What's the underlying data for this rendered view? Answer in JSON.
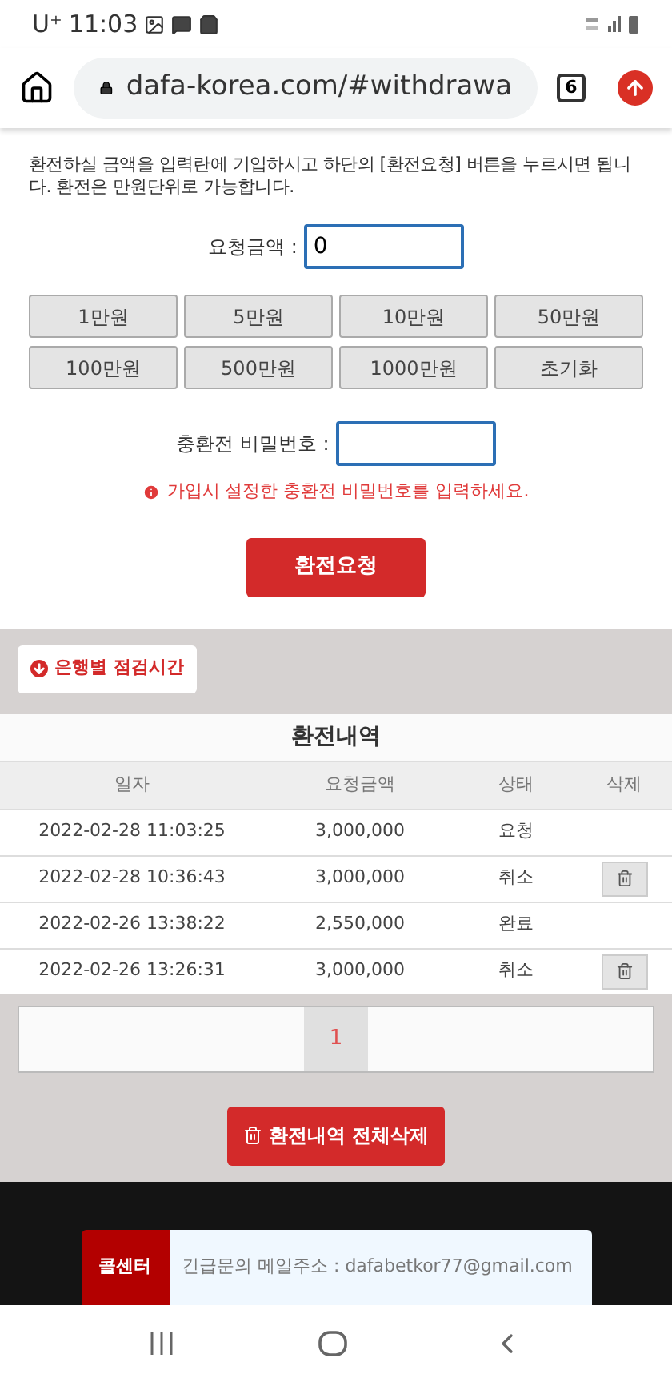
{
  "status_bar": {
    "carrier": "U⁺",
    "time": "11:03"
  },
  "browser": {
    "url": "dafa-korea.com/#withdrawa",
    "tab_count": "6"
  },
  "intro": "환전하실 금액을 입력란에 기입하시고 하단의 [환전요청] 버튼을 누르시면 됩니다. 환전은 만원단위로 가능합니다.",
  "amount": {
    "label": "요청금액 :",
    "value": "0"
  },
  "quick_buttons": [
    "1만원",
    "5만원",
    "10만원",
    "50만원",
    "100만원",
    "500만원",
    "1000만원",
    "초기화"
  ],
  "password": {
    "label": "충환전 비밀번호 :",
    "hint": "가입시 설정한 충환전 비밀번호를 입력하세요."
  },
  "submit": "환전요청",
  "bank_hours_button": "은행별 점검시간",
  "history": {
    "title": "환전내역",
    "columns": [
      "일자",
      "요청금액",
      "상태",
      "삭제"
    ],
    "rows": [
      {
        "date": "2022-02-28 11:03:25",
        "amount": "3,000,000",
        "status": "요청",
        "deletable": false
      },
      {
        "date": "2022-02-28 10:36:43",
        "amount": "3,000,000",
        "status": "취소",
        "deletable": true
      },
      {
        "date": "2022-02-26 13:38:22",
        "amount": "2,550,000",
        "status": "완료",
        "deletable": false
      },
      {
        "date": "2022-02-26 13:26:31",
        "amount": "3,000,000",
        "status": "취소",
        "deletable": true
      }
    ]
  },
  "pagination": [
    {
      "label": "1",
      "selected": true
    }
  ],
  "delete_all": "환전내역 전체삭제",
  "footer": {
    "tag": "콜센터",
    "text": "긴급문의 메일주소 : dafabetkor77@gmail.com"
  }
}
